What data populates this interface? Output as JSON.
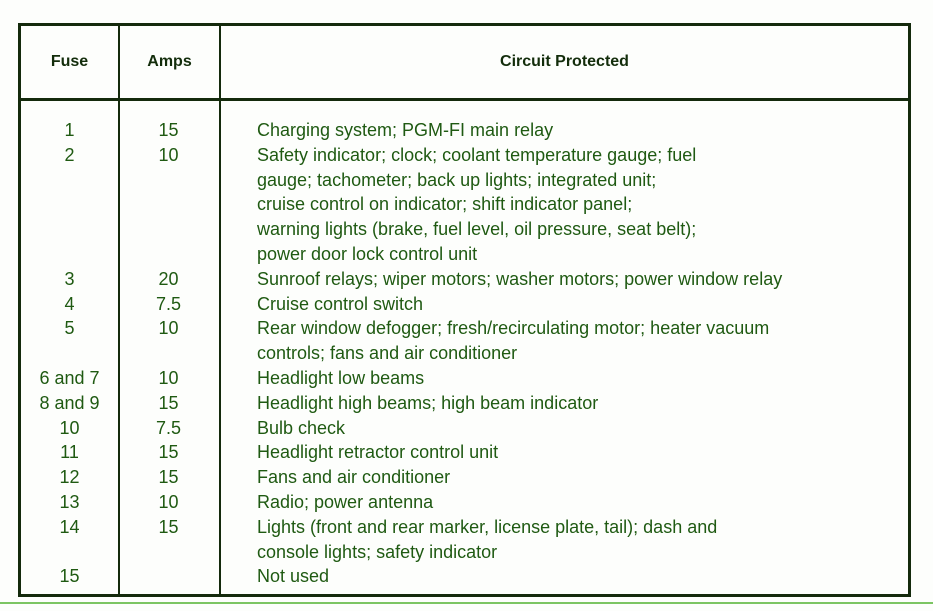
{
  "headers": {
    "fuse": "Fuse",
    "amps": "Amps",
    "circuit": "Circuit Protected"
  },
  "rows": [
    {
      "fuse": "1",
      "amps": "15",
      "circuit": [
        "Charging system; PGM-FI main relay"
      ]
    },
    {
      "fuse": "2",
      "amps": "10",
      "circuit": [
        "Safety indicator; clock; coolant temperature gauge; fuel",
        "gauge; tachometer; back up lights; integrated unit;",
        "cruise control on indicator; shift indicator panel;",
        "warning lights (brake, fuel level, oil pressure, seat belt);",
        "power door lock control unit"
      ]
    },
    {
      "fuse": "3",
      "amps": "20",
      "circuit": [
        "Sunroof relays; wiper motors; washer motors; power window relay"
      ]
    },
    {
      "fuse": "4",
      "amps": "7.5",
      "circuit": [
        "Cruise control switch"
      ]
    },
    {
      "fuse": "5",
      "amps": "10",
      "circuit": [
        "Rear window defogger; fresh/recirculating motor; heater vacuum",
        "controls; fans and air conditioner"
      ]
    },
    {
      "fuse": "6 and 7",
      "amps": "10",
      "circuit": [
        "Headlight low beams"
      ]
    },
    {
      "fuse": "8 and 9",
      "amps": "15",
      "circuit": [
        "Headlight high beams; high beam indicator"
      ]
    },
    {
      "fuse": "10",
      "amps": "7.5",
      "circuit": [
        "Bulb check"
      ]
    },
    {
      "fuse": "11",
      "amps": "15",
      "circuit": [
        "Headlight retractor control unit"
      ]
    },
    {
      "fuse": "12",
      "amps": "15",
      "circuit": [
        "Fans and air conditioner"
      ]
    },
    {
      "fuse": "13",
      "amps": "10",
      "circuit": [
        "Radio; power antenna"
      ]
    },
    {
      "fuse": "14",
      "amps": "15",
      "circuit": [
        "Lights (front and rear marker, license plate, tail); dash and",
        "console lights; safety indicator"
      ]
    },
    {
      "fuse": "15",
      "amps": "",
      "circuit": [
        "Not used"
      ]
    }
  ]
}
